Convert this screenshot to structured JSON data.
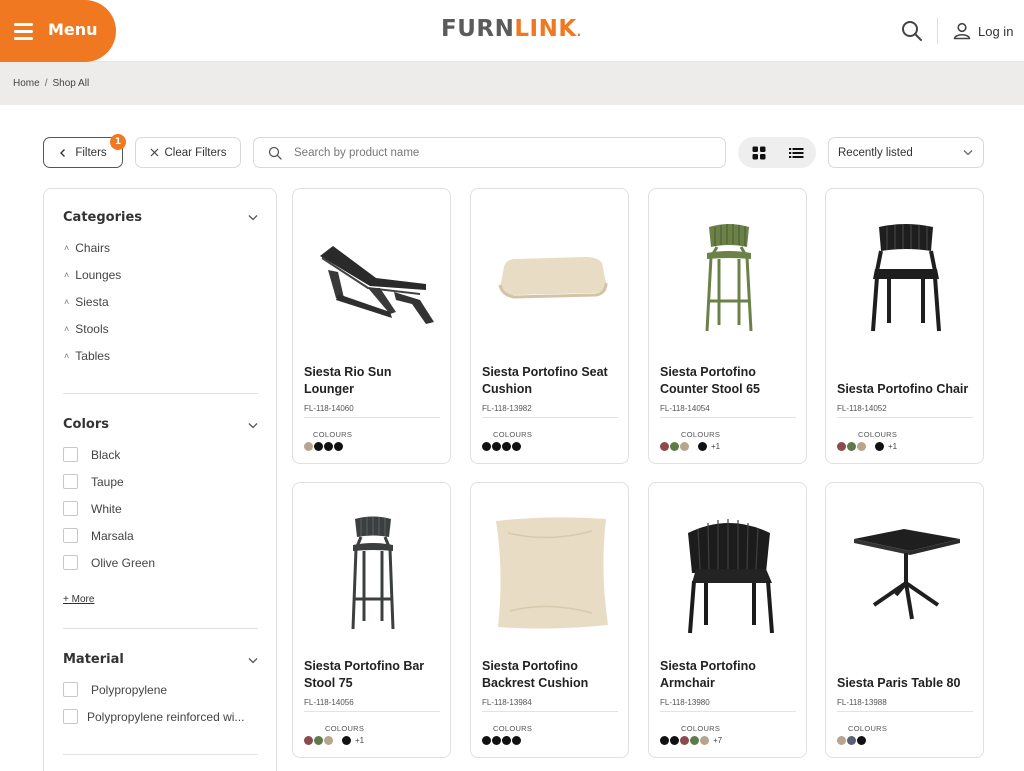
{
  "header": {
    "menu_label": "Menu",
    "logo_main": "FURN",
    "logo_accent": "LINK",
    "logo_dot": ".",
    "login_label": "Log in"
  },
  "breadcrumb": [
    "Home",
    "Shop All"
  ],
  "toolbar": {
    "filters_label": "Filters",
    "filters_count": "1",
    "clear_label": "Clear Filters",
    "search_placeholder": "Search by product name",
    "sort_value": "Recently listed"
  },
  "sidebar": {
    "categories": {
      "title": "Categories",
      "items": [
        "Chairs",
        "Lounges",
        "Siesta",
        "Stools",
        "Tables"
      ]
    },
    "colors": {
      "title": "Colors",
      "items": [
        "Black",
        "Taupe",
        "White",
        "Marsala",
        "Olive Green"
      ],
      "more_label": "+ More"
    },
    "material": {
      "title": "Material",
      "items": [
        "Polypropylene",
        "Polypropylene reinforced wi..."
      ]
    }
  },
  "products": [
    {
      "name": "Siesta Rio Sun Lounger",
      "sku": "FL-118-14060",
      "colours_label": "COLOURS",
      "icon": "sun-lounger-icon",
      "swatches": [
        "#b7a58e",
        "#111111",
        "#111111",
        "#111111"
      ],
      "extra": ""
    },
    {
      "name": "Siesta Portofino Seat Cushion",
      "sku": "FL-118-13982",
      "colours_label": "COLOURS",
      "icon": "seat-cushion-icon",
      "swatches": [
        "#111111",
        "#111111",
        "#111111",
        "#111111"
      ],
      "extra": ""
    },
    {
      "name": "Siesta Portofino Counter Stool 65",
      "sku": "FL-118-14054",
      "colours_label": "COLOURS",
      "icon": "counter-stool-icon",
      "swatches": [
        "#8c4a4c",
        "#5d7a4a",
        "#b7a58e"
      ],
      "swatches2": [
        "#111111"
      ],
      "extra": "+1"
    },
    {
      "name": "Siesta Portofino Chair",
      "sku": "FL-118-14052",
      "colours_label": "COLOURS",
      "icon": "chair-icon",
      "swatches": [
        "#8c4a4c",
        "#5d7a4a",
        "#b7a58e"
      ],
      "swatches2": [
        "#111111"
      ],
      "extra": "+1"
    },
    {
      "name": "Siesta Portofino Bar Stool 75",
      "sku": "FL-118-14056",
      "colours_label": "COLOURS",
      "icon": "bar-stool-icon",
      "swatches": [
        "#8c4a4c",
        "#5d7a4a",
        "#b7a58e"
      ],
      "swatches2": [
        "#111111"
      ],
      "extra": "+1"
    },
    {
      "name": "Siesta Portofino Backrest Cushion",
      "sku": "FL-118-13984",
      "colours_label": "COLOURS",
      "icon": "backrest-cushion-icon",
      "swatches": [
        "#111111",
        "#111111",
        "#111111",
        "#111111"
      ],
      "extra": ""
    },
    {
      "name": "Siesta Portofino Armchair",
      "sku": "FL-118-13980",
      "colours_label": "COLOURS",
      "icon": "armchair-icon",
      "swatches": [
        "#111111",
        "#111111",
        "#8c4a4c",
        "#5d7a4a",
        "#b7a58e"
      ],
      "extra": "+7"
    },
    {
      "name": "Siesta Paris Table 80",
      "sku": "FL-118-13988",
      "colours_label": "COLOURS",
      "icon": "table-icon",
      "swatches": [
        "#b7a58e",
        "#5b5f78",
        "#111111"
      ],
      "extra": ""
    }
  ],
  "colors": {
    "accent": "#f07820",
    "text": "#222222",
    "border": "#e0e0e0"
  }
}
